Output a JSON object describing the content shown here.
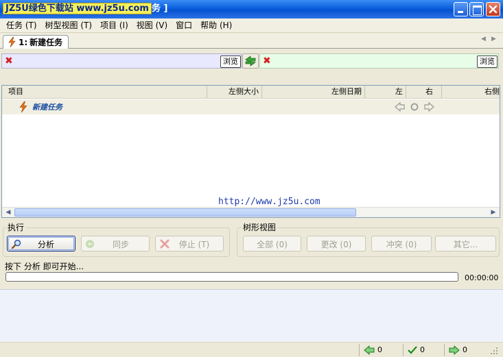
{
  "window": {
    "title_watermark": "JZ5U绿色下载站 www.jz5u.com",
    "title_tail": "务 ]"
  },
  "menu": [
    {
      "label": "任务 (T)"
    },
    {
      "label": "树型视图 (T)"
    },
    {
      "label": "项目 (I)"
    },
    {
      "label": "视图 (V)"
    },
    {
      "label": "窗口"
    },
    {
      "label": "帮助 (H)"
    }
  ],
  "tab": {
    "index": "1:",
    "label": "新建任务"
  },
  "paths": {
    "left_browse": "浏览",
    "right_browse": "浏览",
    "left_bg": "#e8e8ff",
    "right_bg": "#e8fde8"
  },
  "list": {
    "columns": [
      {
        "label": "项目"
      },
      {
        "label": "左侧大小"
      },
      {
        "label": "左侧日期"
      },
      {
        "label": "左"
      },
      {
        "label": "右"
      },
      {
        "label": "右侧"
      }
    ],
    "row": {
      "name": "新建任务",
      "icon": "task-lightning-icon"
    }
  },
  "watermark_url": "http://www.jz5u.com",
  "execute": {
    "title": "执行",
    "analyze": "分析",
    "sync": "同步",
    "stop": "停止 (T)"
  },
  "tree": {
    "title": "树形视图",
    "all": "全部 (0)",
    "changed": "更改 (0)",
    "conflict": "冲突 (0)",
    "other": "其它..."
  },
  "status": {
    "hint": "按下 分析 即可开始...",
    "time": "00:00:00",
    "progress": 0,
    "count_left": "0",
    "count_equal": "0",
    "count_right": "0"
  },
  "colors": {
    "accent_blue": "#0552d1",
    "error_red": "#d32020",
    "ok_green": "#2e9b2e"
  }
}
